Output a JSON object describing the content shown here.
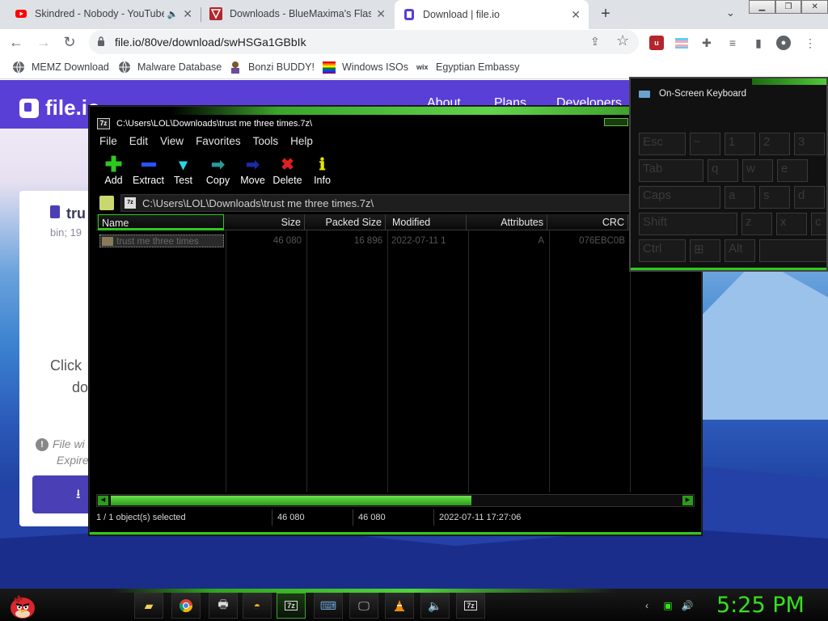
{
  "browser": {
    "tabs": [
      {
        "title": "Skindred - Nobody - YouTube",
        "favicon": "youtube-icon",
        "active": false,
        "audio": true
      },
      {
        "title": "Downloads - BlueMaxima's Flashpoint",
        "favicon": "flashpoint-icon",
        "active": false,
        "audio": false
      },
      {
        "title": "Download | file.io",
        "favicon": "fileio-icon",
        "active": true,
        "audio": false
      }
    ],
    "url": "file.io/80ve/download/swHSGa1GBbIk",
    "bookmarks": [
      {
        "label": "MEMZ Download",
        "icon": "globe-icon"
      },
      {
        "label": "Malware Database",
        "icon": "globe-icon"
      },
      {
        "label": "Bonzi BUDDY!",
        "icon": "bonzi-icon"
      },
      {
        "label": "Windows ISOs",
        "icon": "windows-icon"
      },
      {
        "label": "Egyptian Embassy",
        "icon": "wix-icon"
      }
    ]
  },
  "fileio": {
    "logo": "file.io",
    "nav": [
      "About",
      "Plans",
      "Developers"
    ],
    "file_name": "tru",
    "file_meta": "bin; 19",
    "click_text": "Click",
    "click_text2": "do",
    "warn_text": "File wi",
    "expire_text": "Expire"
  },
  "sevenzip": {
    "title": "C:\\Users\\LOL\\Downloads\\trust me three times.7z\\",
    "menu": [
      "File",
      "Edit",
      "View",
      "Favorites",
      "Tools",
      "Help"
    ],
    "toolbar": [
      {
        "label": "Add",
        "icon": "plus-icon",
        "color": "#2ec91e"
      },
      {
        "label": "Extract",
        "icon": "minus-icon",
        "color": "#2255ff"
      },
      {
        "label": "Test",
        "icon": "check-icon",
        "color": "#26d7e6"
      },
      {
        "label": "Copy",
        "icon": "copy-arrow-icon",
        "color": "#2a9a9a"
      },
      {
        "label": "Move",
        "icon": "move-arrow-icon",
        "color": "#1a2aa8"
      },
      {
        "label": "Delete",
        "icon": "delete-x-icon",
        "color": "#e02020"
      },
      {
        "label": "Info",
        "icon": "info-icon",
        "color": "#e6e600"
      }
    ],
    "path": "C:\\Users\\LOL\\Downloads\\trust me three times.7z\\",
    "columns": [
      "Name",
      "Size",
      "Packed Size",
      "Modified",
      "Attributes",
      "CRC"
    ],
    "rows": [
      {
        "name": "trust me three times",
        "size": "46 080",
        "packed": "16 896",
        "modified": "2022-07-11 1",
        "attributes": "A",
        "crc": "076EBC0B"
      }
    ],
    "status": {
      "selected": "1 / 1 object(s) selected",
      "size": "46 080",
      "packed": "46 080",
      "modified": "2022-07-11 17:27:06"
    }
  },
  "osk": {
    "title": "On-Screen Keyboard",
    "keys": [
      "Esc",
      "~",
      "1",
      "2",
      "3",
      "Tab",
      "q",
      "w",
      "e",
      "Caps",
      "a",
      "s",
      "d",
      "Shift",
      "z",
      "x",
      "c",
      "Ctrl",
      "⊞",
      "Alt",
      ""
    ]
  },
  "taskbar": {
    "clock": "5:25 PM",
    "apps": [
      "file-explorer-icon",
      "chrome-icon",
      "printer-icon",
      "paint-icon",
      "7zip-icon",
      "keyboard-icon",
      "display-icon",
      "vlc-icon",
      "speaker-icon",
      "7zip-icon"
    ]
  }
}
